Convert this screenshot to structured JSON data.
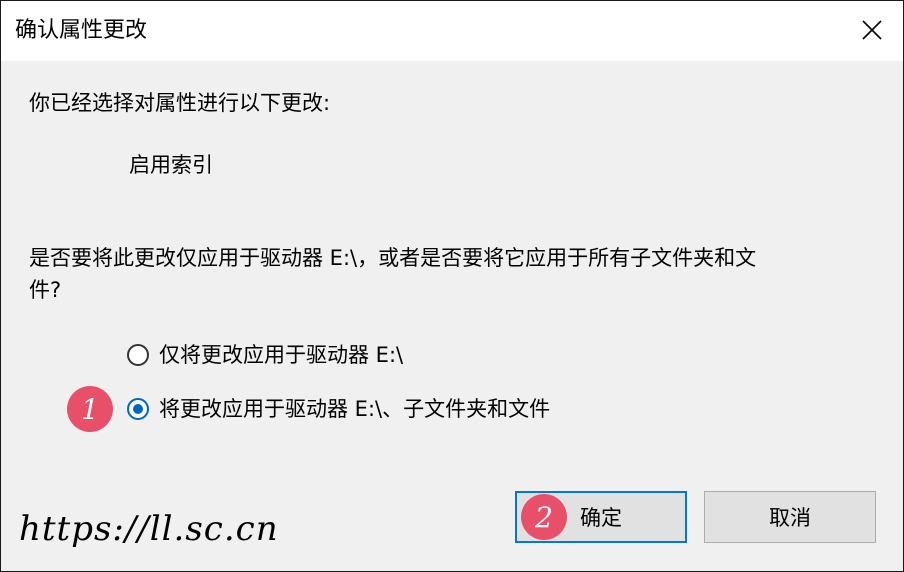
{
  "window": {
    "title": "确认属性更改",
    "close_icon": "close-icon"
  },
  "body": {
    "intro": "你已经选择对属性进行以下更改:",
    "change_item": "启用索引",
    "question": "是否要将此更改仅应用于驱动器 E:\\，或者是否要将它应用于所有子文件夹和文件?",
    "question_line1": "是否要将此更改仅应用于驱动器 E:\\，或者是否要将它应用于所有子文件夹和文",
    "question_line2": "件?"
  },
  "options": [
    {
      "label": "仅将更改应用于驱动器 E:\\",
      "selected": false
    },
    {
      "label": "将更改应用于驱动器 E:\\、子文件夹和文件",
      "selected": true
    }
  ],
  "buttons": {
    "ok": "确定",
    "cancel": "取消"
  },
  "annotations": {
    "step1": "1",
    "step2": "2",
    "step_color": "#e8506a"
  },
  "watermark": "https://ll.sc.cn",
  "colors": {
    "accent": "#0067c0",
    "dialog_bg": "#f0f0f0"
  }
}
